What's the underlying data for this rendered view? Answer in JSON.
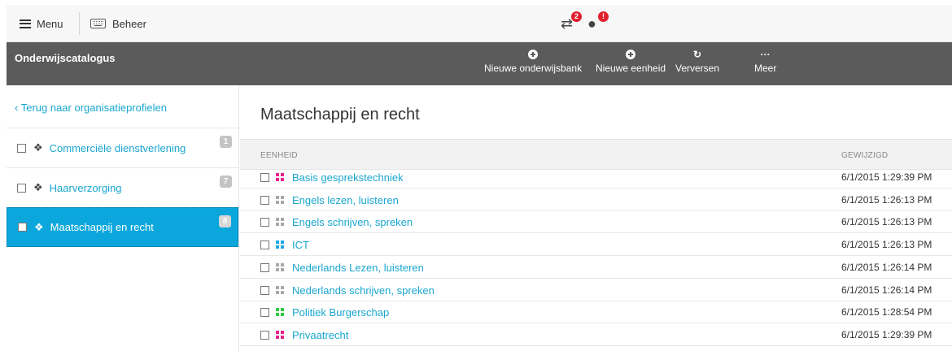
{
  "topbar": {
    "menu_label": "Menu",
    "beheer_label": "Beheer",
    "notifications": [
      {
        "icon": "transfer-arrows-icon",
        "badge": "2"
      },
      {
        "icon": "globe-icon",
        "badge": "!"
      }
    ]
  },
  "toolbar": {
    "title": "Onderwijscatalogus",
    "actions": [
      {
        "label": "Nieuwe onderwijsbank",
        "icon": "plus-circle-icon"
      },
      {
        "label": "Nieuwe eenheid",
        "icon": "plus-circle-icon"
      },
      {
        "label": "Verversen",
        "icon": "refresh-icon"
      },
      {
        "label": "Meer",
        "icon": "ellipsis-icon"
      }
    ]
  },
  "sidebar": {
    "back_label": "Terug naar organisatieprofielen",
    "items": [
      {
        "label": "Commerciële dienstverlening",
        "count": "1"
      },
      {
        "label": "Haarverzorging",
        "count": "7"
      },
      {
        "label": "Maatschappij en recht",
        "count": "8",
        "active": true
      }
    ]
  },
  "main": {
    "title": "Maatschappij en recht",
    "columns": [
      "EENHEID",
      "GEWIJZIGD"
    ],
    "rows": [
      {
        "name": "Basis gesprekstechniek",
        "modified": "6/1/2015 1:29:39 PM",
        "tile_color": "#e91e8c"
      },
      {
        "name": "Engels lezen, luisteren",
        "modified": "6/1/2015 1:26:13 PM",
        "tile_color": "#a8a8a8"
      },
      {
        "name": "Engels schrijven, spreken",
        "modified": "6/1/2015 1:26:13 PM",
        "tile_color": "#a8a8a8"
      },
      {
        "name": "ICT",
        "modified": "6/1/2015 1:26:13 PM",
        "tile_color": "#1aa6e8"
      },
      {
        "name": "Nederlands Lezen, luisteren",
        "modified": "6/1/2015 1:26:14 PM",
        "tile_color": "#a8a8a8"
      },
      {
        "name": "Nederlands schrijven, spreken",
        "modified": "6/1/2015 1:26:14 PM",
        "tile_color": "#a8a8a8"
      },
      {
        "name": "Politiek Burgerschap",
        "modified": "6/1/2015 1:28:54 PM",
        "tile_color": "#2ecc40"
      },
      {
        "name": "Privaatrecht",
        "modified": "6/1/2015 1:29:39 PM",
        "tile_color": "#e91e8c"
      }
    ]
  },
  "colors": {
    "accent": "#1aa6cf",
    "active_bg": "#0aa6dc",
    "toolbar_bg": "#5b5b5b",
    "badge": "#e0202e"
  }
}
